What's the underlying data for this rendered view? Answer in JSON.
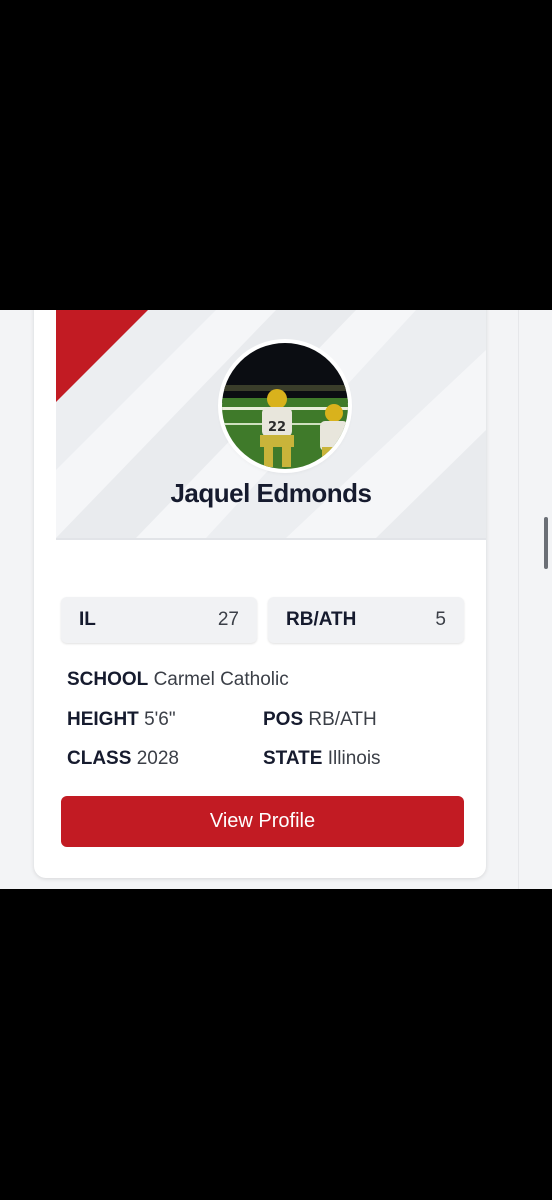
{
  "player": {
    "name": "Jaquel Edmonds",
    "photo_icon": "player-photo",
    "state_rank": {
      "label": "IL",
      "value": "27"
    },
    "position_rank": {
      "label": "RB/ATH",
      "value": "5"
    },
    "school_label": "SCHOOL",
    "school": "Carmel Catholic",
    "height_label": "HEIGHT",
    "height": "5'6\"",
    "pos_label": "POS",
    "pos": "RB/ATH",
    "class_label": "CLASS",
    "class": "2028",
    "state_label": "STATE",
    "state": "Illinois"
  },
  "actions": {
    "view_profile": "View Profile"
  },
  "colors": {
    "accent": "#c21b23",
    "text": "#161b2e"
  }
}
